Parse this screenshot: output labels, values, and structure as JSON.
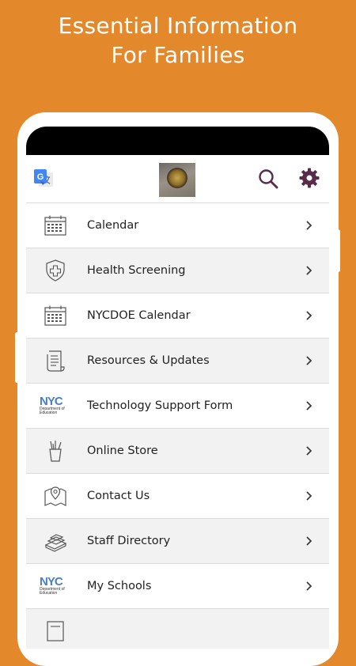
{
  "headline": {
    "line1": "Essential Information",
    "line2": "For Families"
  },
  "colors": {
    "background": "#E3892B",
    "icon_purple": "#5A2A4A",
    "row_alt": "#f2f2f2"
  },
  "appbar": {
    "translate_icon": "google-translate-icon",
    "search_icon": "search-icon",
    "settings_icon": "gear-icon"
  },
  "menu": [
    {
      "label": "Calendar",
      "icon": "calendar-icon"
    },
    {
      "label": "Health Screening",
      "icon": "shield-plus-icon"
    },
    {
      "label": "NYCDOE Calendar",
      "icon": "calendar-icon"
    },
    {
      "label": "Resources & Updates",
      "icon": "document-icon"
    },
    {
      "label": "Technology Support Form",
      "icon": "nyc-doe-logo"
    },
    {
      "label": "Online Store",
      "icon": "pencil-cup-icon"
    },
    {
      "label": "Contact Us",
      "icon": "map-pin-icon"
    },
    {
      "label": "Staff Directory",
      "icon": "books-icon"
    },
    {
      "label": "My Schools",
      "icon": "nyc-doe-logo"
    }
  ],
  "nyc_logo": {
    "mark": "NYC",
    "subtitle_line1": "Department of",
    "subtitle_line2": "Education"
  }
}
